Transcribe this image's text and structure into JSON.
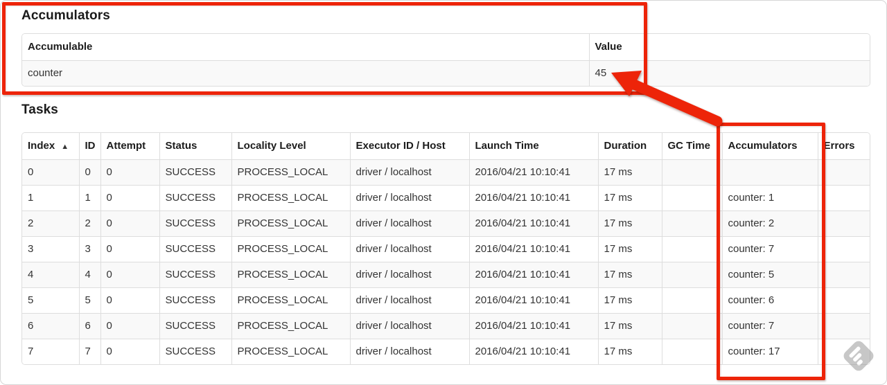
{
  "colors": {
    "annotation_red": "#ed2409",
    "row_stripe": "#f9f9f9",
    "table_border": "#dddddd"
  },
  "accumulators_section": {
    "heading": "Accumulators",
    "table": {
      "col_accumulable": "Accumulable",
      "col_value": "Value",
      "rows": [
        {
          "accumulable": "counter",
          "value": "45"
        }
      ]
    }
  },
  "tasks_section": {
    "heading": "Tasks",
    "table": {
      "headers": [
        "Index",
        "ID",
        "Attempt",
        "Status",
        "Locality Level",
        "Executor ID / Host",
        "Launch Time",
        "Duration",
        "GC Time",
        "Accumulators",
        "Errors"
      ],
      "sort_indicator": "▲",
      "rows": [
        {
          "index": "0",
          "id": "0",
          "attempt": "0",
          "status": "SUCCESS",
          "locality_level": "PROCESS_LOCAL",
          "executor_id_host": "driver / localhost",
          "launch_time": "2016/04/21 10:10:41",
          "duration": "17 ms",
          "gc_time": "",
          "accumulators": "",
          "errors": ""
        },
        {
          "index": "1",
          "id": "1",
          "attempt": "0",
          "status": "SUCCESS",
          "locality_level": "PROCESS_LOCAL",
          "executor_id_host": "driver / localhost",
          "launch_time": "2016/04/21 10:10:41",
          "duration": "17 ms",
          "gc_time": "",
          "accumulators": "counter: 1",
          "errors": ""
        },
        {
          "index": "2",
          "id": "2",
          "attempt": "0",
          "status": "SUCCESS",
          "locality_level": "PROCESS_LOCAL",
          "executor_id_host": "driver / localhost",
          "launch_time": "2016/04/21 10:10:41",
          "duration": "17 ms",
          "gc_time": "",
          "accumulators": "counter: 2",
          "errors": ""
        },
        {
          "index": "3",
          "id": "3",
          "attempt": "0",
          "status": "SUCCESS",
          "locality_level": "PROCESS_LOCAL",
          "executor_id_host": "driver / localhost",
          "launch_time": "2016/04/21 10:10:41",
          "duration": "17 ms",
          "gc_time": "",
          "accumulators": "counter: 7",
          "errors": ""
        },
        {
          "index": "4",
          "id": "4",
          "attempt": "0",
          "status": "SUCCESS",
          "locality_level": "PROCESS_LOCAL",
          "executor_id_host": "driver / localhost",
          "launch_time": "2016/04/21 10:10:41",
          "duration": "17 ms",
          "gc_time": "",
          "accumulators": "counter: 5",
          "errors": ""
        },
        {
          "index": "5",
          "id": "5",
          "attempt": "0",
          "status": "SUCCESS",
          "locality_level": "PROCESS_LOCAL",
          "executor_id_host": "driver / localhost",
          "launch_time": "2016/04/21 10:10:41",
          "duration": "17 ms",
          "gc_time": "",
          "accumulators": "counter: 6",
          "errors": ""
        },
        {
          "index": "6",
          "id": "6",
          "attempt": "0",
          "status": "SUCCESS",
          "locality_level": "PROCESS_LOCAL",
          "executor_id_host": "driver / localhost",
          "launch_time": "2016/04/21 10:10:41",
          "duration": "17 ms",
          "gc_time": "",
          "accumulators": "counter: 7",
          "errors": ""
        },
        {
          "index": "7",
          "id": "7",
          "attempt": "0",
          "status": "SUCCESS",
          "locality_level": "PROCESS_LOCAL",
          "executor_id_host": "driver / localhost",
          "launch_time": "2016/04/21 10:10:41",
          "duration": "17 ms",
          "gc_time": "",
          "accumulators": "counter: 17",
          "errors": ""
        }
      ]
    }
  },
  "annotations": {
    "box1_target": "accumulators-summary",
    "box2_target": "accumulators-column",
    "arrow_target": "value-45"
  },
  "icons": {
    "watermark": "feedly-watermark-icon",
    "sort": "sort-ascending-icon"
  }
}
